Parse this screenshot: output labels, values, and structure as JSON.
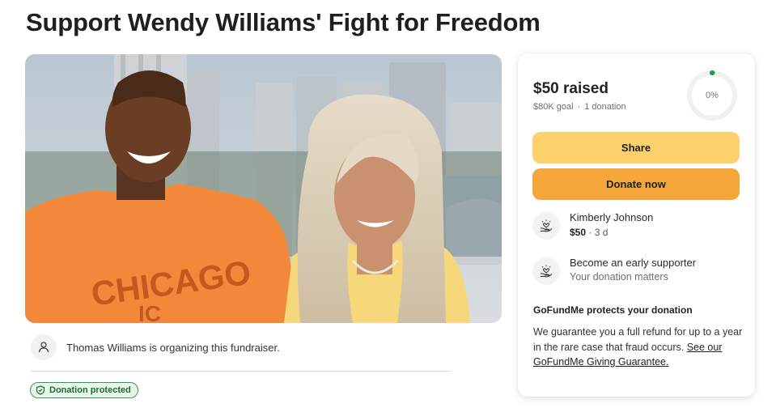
{
  "page": {
    "title": "Support Wendy Williams' Fight for Freedom"
  },
  "organizer": {
    "text": "Thomas Williams is organizing this fundraiser.",
    "avatar_icon": "person-icon"
  },
  "badge": {
    "label": "Donation protected",
    "icon": "shield-check-icon",
    "color": "#2e9b4f"
  },
  "hero_image": {
    "shirt_text": "CHICAGO",
    "shirt_subtext": "IC"
  },
  "donation_card": {
    "raised": "$50 raised",
    "goal": "$80K goal",
    "donations": "1 donation",
    "progress_label": "0%",
    "progress_fraction": 0.0006,
    "share_label": "Share",
    "donate_label": "Donate now",
    "donor": {
      "name": "Kimberly Johnson",
      "amount": "$50",
      "time": "3 d",
      "icon": "heart-hand-icon"
    },
    "early": {
      "title": "Become an early supporter",
      "subtitle": "Your donation matters",
      "icon": "heart-hand-icon"
    },
    "protect": {
      "title": "GoFundMe protects your donation",
      "body": "We guarantee you a full refund for up to a year in the rare case that fraud occurs. ",
      "link": "See our GoFundMe Giving Guarantee."
    },
    "colors": {
      "share": "#fcd06a",
      "donate": "#f4a63b",
      "ring_accent": "#1aa14a"
    }
  }
}
